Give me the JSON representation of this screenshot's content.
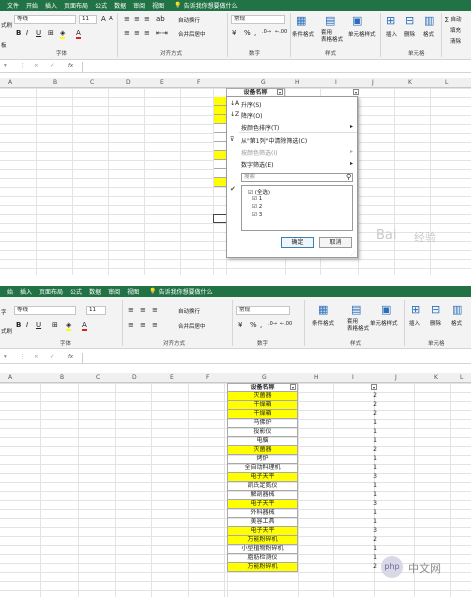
{
  "menubar_top": {
    "items": [
      "文件",
      "开始",
      "插入",
      "页面布局",
      "公式",
      "数据",
      "审阅",
      "视图"
    ],
    "tell_me": "告诉我你想要做什么"
  },
  "menubar_bottom": {
    "items": [
      "始",
      "插入",
      "页面布局",
      "公式",
      "数据",
      "审阅",
      "视图"
    ],
    "tell_me": "告诉我你想要做什么"
  },
  "ribbon_top": {
    "font_name": "等线",
    "font_size": "11",
    "bold": "B",
    "italic": "I",
    "underline": "U",
    "grow": "A",
    "shrink": "A",
    "wrap": "自动换行",
    "merge": "合并后居中",
    "number_format": "常规",
    "percent": "%",
    "comma": ",",
    "conditional": "条件格式",
    "table_format": "套用\n表格格式",
    "cell_style": "单元格样式",
    "insert": "插入",
    "delete": "删除",
    "format": "格式",
    "autosum": "∑ 自动",
    "fill": "填充",
    "clear": "清除",
    "group_font": "字体",
    "group_align": "对齐方式",
    "group_number": "数字",
    "group_style": "样式",
    "group_cells": "单元格",
    "left_edge": [
      "式刷",
      "板"
    ]
  },
  "ribbon_bottom": {
    "font_name": "等线",
    "font_size": "11",
    "bold": "B",
    "italic": "I",
    "underline": "U",
    "wrap": "自动换行",
    "merge": "合并后居中",
    "number_format": "常规",
    "percent": "%",
    "comma": ",",
    "conditional": "条件格式",
    "table_format": "套用\n表格格式",
    "cell_style": "单元格样式",
    "insert": "插入",
    "delete": "删除",
    "format": "格式",
    "group_font": "字体",
    "group_align": "对齐方式",
    "group_number": "数字",
    "group_style": "样式",
    "group_cells": "单元格",
    "left_edge": [
      "字",
      "式刷"
    ]
  },
  "formula_bar": {
    "fx": "fx",
    "cancel": "×",
    "enter": "✓"
  },
  "columns": [
    "A",
    "B",
    "C",
    "D",
    "E",
    "F",
    "G",
    "H",
    "I",
    "J",
    "K",
    "L"
  ],
  "header_cell": "设备名称",
  "filter_menu": {
    "sort_asc": "升序(S)",
    "sort_desc": "降序(O)",
    "sort_color": "按颜色排序(T)",
    "clear_filter": "从\"第1列\"中清除筛选(C)",
    "filter_color": "按颜色筛选(I)",
    "number_filter": "数字筛选(E)",
    "search_placeholder": "搜索",
    "select_all": "(全选)",
    "opt1": "1",
    "opt2": "2",
    "opt3": "3",
    "ok": "确定",
    "cancel": "取消"
  },
  "rows": [
    {
      "name": "灭菌器",
      "value": "2",
      "yellow": true
    },
    {
      "name": "干燥箱",
      "value": "2",
      "yellow": true
    },
    {
      "name": "干燥箱",
      "value": "2",
      "yellow": true
    },
    {
      "name": "马佛炉",
      "value": "1",
      "yellow": false
    },
    {
      "name": "投影仪",
      "value": "1",
      "yellow": false
    },
    {
      "name": "电脑",
      "value": "1",
      "yellow": false
    },
    {
      "name": "灭菌器",
      "value": "2",
      "yellow": true
    },
    {
      "name": "烤炉",
      "value": "1",
      "yellow": false
    },
    {
      "name": "全自动料理机",
      "value": "1",
      "yellow": false
    },
    {
      "name": "电子天平",
      "value": "3",
      "yellow": true
    },
    {
      "name": "凯氏定氮仪",
      "value": "1",
      "yellow": false
    },
    {
      "name": "解剖器械",
      "value": "1",
      "yellow": false
    },
    {
      "name": "电子天平",
      "value": "3",
      "yellow": true
    },
    {
      "name": "外科器械",
      "value": "1",
      "yellow": false
    },
    {
      "name": "美容工具",
      "value": "1",
      "yellow": false
    },
    {
      "name": "电子天平",
      "value": "3",
      "yellow": true
    },
    {
      "name": "万能粉碎机",
      "value": "2",
      "yellow": true
    },
    {
      "name": "小型植物粉碎机",
      "value": "1",
      "yellow": false
    },
    {
      "name": "脂肪检测仪",
      "value": "1",
      "yellow": false
    },
    {
      "name": "万能粉碎机",
      "value": "2",
      "yellow": true
    }
  ],
  "watermarks": {
    "baidu": "Bai",
    "jingyan": "经验",
    "php": "php",
    "cn": "中文网"
  },
  "colors": {
    "excel_green": "#217346",
    "highlight": "#ffff00"
  }
}
